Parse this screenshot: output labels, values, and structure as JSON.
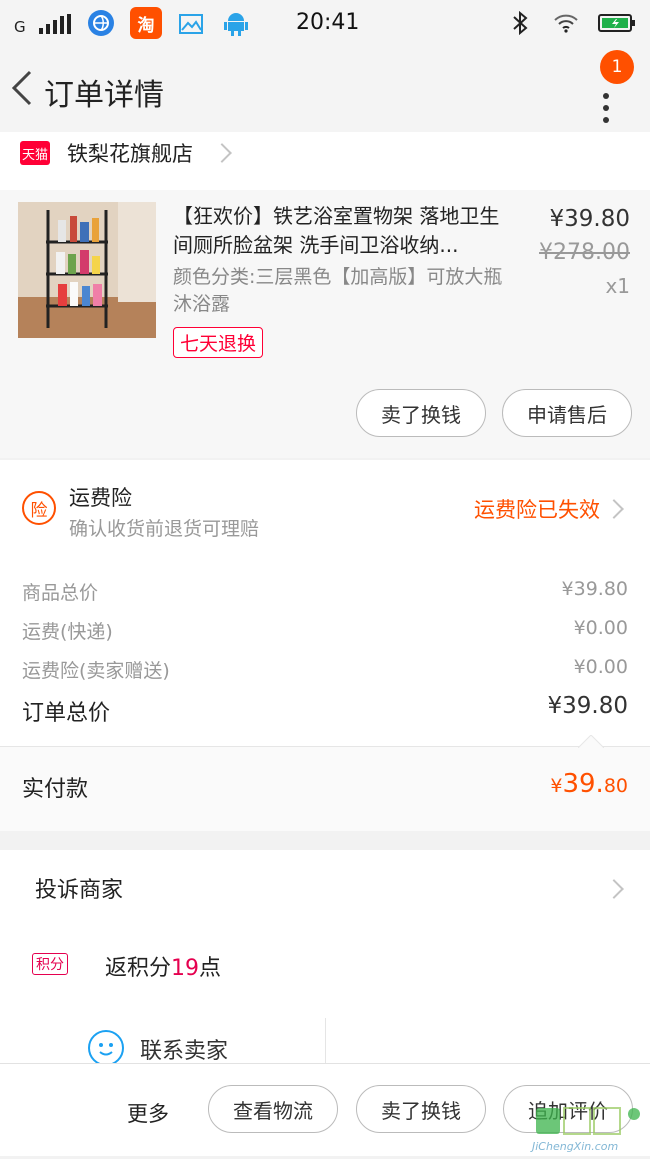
{
  "status_bar": {
    "carrier": "G",
    "time": "20:41",
    "taobao_icon_glyph": "淘"
  },
  "header": {
    "title": "订单详情",
    "notification_count": "1"
  },
  "store": {
    "badge": "天猫",
    "name": "铁梨花旗舰店"
  },
  "product": {
    "title": "【狂欢价】铁艺浴室置物架 落地卫生间厕所脸盆架 洗手间卫浴收纳...",
    "sku": "颜色分类:三层黑色【加高版】可放大瓶沐浴露",
    "tag": "七天退换",
    "price": "¥39.80",
    "original_price": "¥278.00",
    "quantity": "x1",
    "actions": [
      "卖了换钱",
      "申请售后"
    ]
  },
  "insurance": {
    "icon_glyph": "险",
    "title": "运费险",
    "subtitle": "确认收货前退货可理赔",
    "status": "运费险已失效"
  },
  "totals": {
    "rows": [
      {
        "label": "商品总价",
        "value": "¥39.80"
      },
      {
        "label": "运费(快递)",
        "value": "¥0.00"
      },
      {
        "label": "运费险(卖家赠送)",
        "value": "¥0.00"
      }
    ],
    "order_total_label": "订单总价",
    "order_total_value": "¥39.80",
    "paid_label": "实付款",
    "paid_currency": "¥",
    "paid_int": "39.",
    "paid_dec": "80"
  },
  "links": {
    "complain": "投诉商家",
    "points_badge": "积分",
    "rebate_prefix": "返积分",
    "rebate_points": "19",
    "rebate_suffix": "点",
    "contact": "联系卖家"
  },
  "bottom_bar": {
    "more": "更多",
    "buttons": [
      "查看物流",
      "卖了换钱",
      "追加评价"
    ]
  },
  "watermark": {
    "text": "JiChengXin.com"
  },
  "colors": {
    "accent_orange": "#ff5000",
    "tmall_red": "#ff0036",
    "points_red": "#e5004f",
    "contact_blue": "#1ba1f2"
  }
}
